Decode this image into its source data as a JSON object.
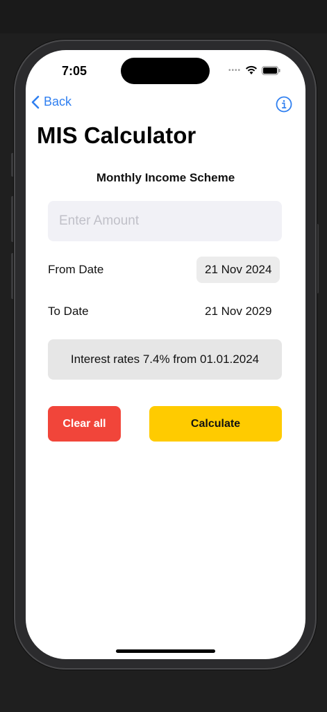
{
  "status_bar": {
    "time": "7:05",
    "signal_dots": "••••"
  },
  "nav": {
    "back_label": "Back"
  },
  "page": {
    "title": "MIS Calculator",
    "subtitle": "Monthly Income Scheme"
  },
  "form": {
    "amount_placeholder": "Enter Amount",
    "amount_value": "",
    "from_label": "From Date",
    "from_value": "21 Nov 2024",
    "to_label": "To Date",
    "to_value": "21 Nov 2029",
    "rate_text": "Interest rates 7.4% from 01.01.2024"
  },
  "actions": {
    "clear_label": "Clear all",
    "calculate_label": "Calculate"
  },
  "colors": {
    "accent_blue": "#2f7ff0",
    "clear_red": "#f1453a",
    "calculate_yellow": "#ffcb00"
  },
  "icons": {
    "back": "chevron-left-icon",
    "info": "info-circle-icon",
    "wifi": "wifi-icon",
    "battery": "battery-icon"
  }
}
